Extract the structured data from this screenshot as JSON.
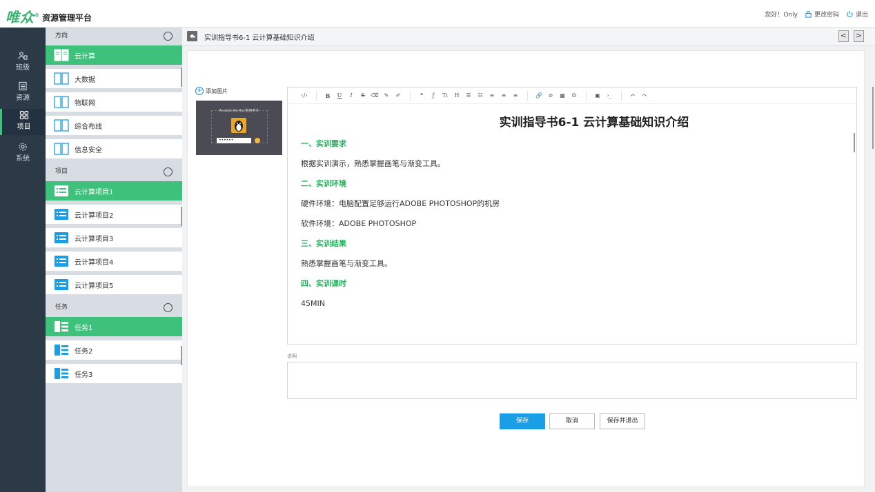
{
  "header": {
    "logo_mark": "唯众",
    "logo_reg": "®",
    "logo_text": "资源管理平台",
    "greeting": "您好！Only",
    "change_password": "更改密码",
    "logout": "退出"
  },
  "leftnav": {
    "items": [
      {
        "label": "班级",
        "icon": "class-icon"
      },
      {
        "label": "资源",
        "icon": "resource-icon"
      },
      {
        "label": "项目",
        "icon": "project-icon",
        "active": true
      },
      {
        "label": "系统",
        "icon": "gear-icon"
      }
    ]
  },
  "sections": {
    "direction": {
      "title": "方向",
      "items": [
        "云计算",
        "大数据",
        "物联网",
        "综合布线",
        "信息安全"
      ]
    },
    "project": {
      "title": "项目",
      "items": [
        "云计算项目1",
        "云计算项目2",
        "云计算项目3",
        "云计算项目4",
        "云计算项目5"
      ]
    },
    "task": {
      "title": "任务",
      "items": [
        "任务1",
        "任务2",
        "任务3"
      ]
    }
  },
  "main": {
    "page_title": "实训指导书6-1 云计算基础知识介绍",
    "prev_label": "<",
    "next_label": ">",
    "add_image": "添加图片",
    "thumb_title": "Ansible Ad-Hoc常用命令",
    "thumb_pwd": "••••••"
  },
  "toolbar": {
    "buttons": [
      "‹/›",
      "B",
      "U",
      "I",
      "S",
      "⌫",
      "✎",
      "✐",
      "❝",
      "ƒ",
      "Tı",
      "H",
      "☰",
      "☷",
      "≡",
      "≡",
      "≡",
      "🔗",
      "⊘",
      "▦",
      "☺",
      "▣",
      "›_",
      "↶",
      "↷"
    ]
  },
  "document": {
    "title": "实训指导书6-1 云计算基础知识介绍",
    "s1": "一、实训要求",
    "p1": "根据实训演示，熟悉掌握画笔与渐变工具。",
    "s2": "二、实训环境",
    "p2": "硬件环境：电脑配置足够运行ADOBE PHOTOSHOP的机房",
    "p3": "软件环境：ADOBE PHOTOSHOP",
    "s3": "三、实训结果",
    "p4": "熟悉掌握画笔与渐变工具。",
    "s4": "四、实训课时",
    "p5": "45MIN"
  },
  "form": {
    "desc_label": "说明",
    "desc_value": "",
    "save": "保存",
    "cancel": "取消",
    "save_exit": "保存并退出"
  },
  "colors": {
    "accent_green": "#3ec27b",
    "heading_green": "#22b35c",
    "primary_blue": "#1a9ee6",
    "nav_dark": "#2c3a48"
  }
}
